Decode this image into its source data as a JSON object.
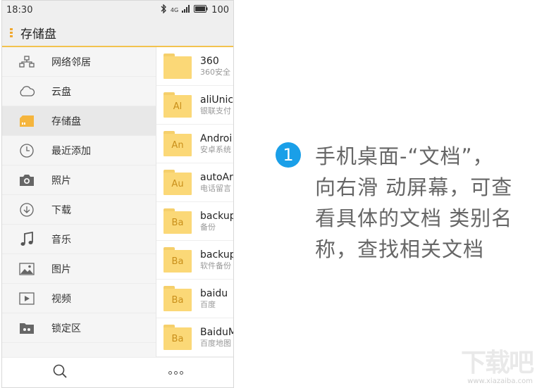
{
  "status": {
    "time": "18:30",
    "signal": "4G",
    "battery": "100"
  },
  "appbar": {
    "title": "存储盘"
  },
  "sidebar": {
    "items": [
      {
        "label": "网络邻居",
        "icon": "network-icon"
      },
      {
        "label": "云盘",
        "icon": "cloud-icon"
      },
      {
        "label": "存储盘",
        "icon": "sd-card-icon",
        "active": true
      },
      {
        "label": "最近添加",
        "icon": "clock-icon"
      },
      {
        "label": "照片",
        "icon": "camera-icon"
      },
      {
        "label": "下载",
        "icon": "download-icon"
      },
      {
        "label": "音乐",
        "icon": "music-icon"
      },
      {
        "label": "图片",
        "icon": "image-icon"
      },
      {
        "label": "视频",
        "icon": "video-icon"
      },
      {
        "label": "锁定区",
        "icon": "lock-folder-icon"
      }
    ]
  },
  "files": [
    {
      "name": "360",
      "sub": "360安全",
      "badge": ""
    },
    {
      "name": "aliUnic",
      "sub": "银联支付",
      "badge": "Al"
    },
    {
      "name": "Androi",
      "sub": "安卓系统",
      "badge": "An"
    },
    {
      "name": "autoAr",
      "sub": "电话留言",
      "badge": "Au"
    },
    {
      "name": "backup",
      "sub": "备份",
      "badge": "Ba"
    },
    {
      "name": "backup",
      "sub": "软件备份",
      "badge": "Ba"
    },
    {
      "name": "baidu",
      "sub": "百度",
      "badge": "Ba"
    },
    {
      "name": "BaiduM",
      "sub": "百度地图",
      "badge": "Ba"
    }
  ],
  "annotation": {
    "number": "1",
    "line1": "手机桌面-“文档”，",
    "line2": "向右滑 动屏幕，可查",
    "line3": "看具体的文档 类别名",
    "line4": "称，查找相关文档"
  },
  "watermark": {
    "logo": "下载吧",
    "url": "www.xiazaiba.com"
  },
  "colors": {
    "accent": "#f2c24e",
    "folder": "#fbd877",
    "badge": "#1a9fe8"
  }
}
